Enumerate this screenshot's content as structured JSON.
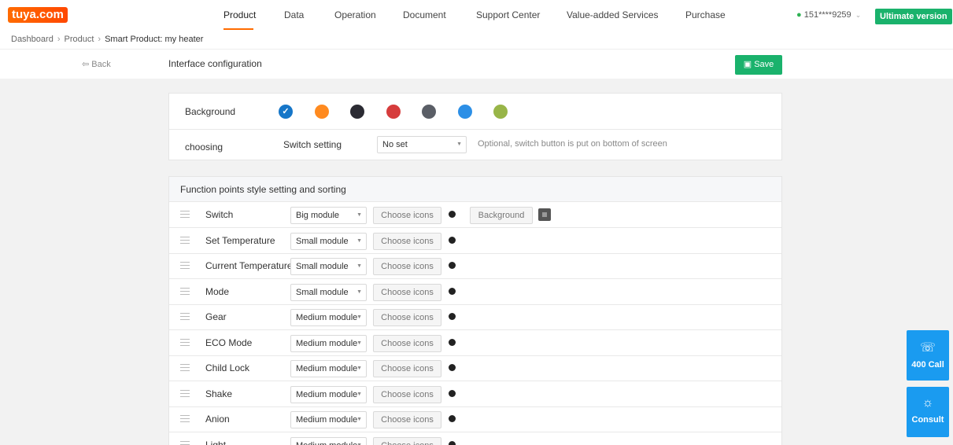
{
  "brand": {
    "logo": "tuya.com"
  },
  "nav": {
    "items": [
      {
        "label": "Product",
        "active": true
      },
      {
        "label": "Data"
      },
      {
        "label": "Operation"
      },
      {
        "label": "Document"
      },
      {
        "label": "Support Center"
      },
      {
        "label": "Value-added Services"
      },
      {
        "label": "Purchase"
      }
    ],
    "user": "151****9259",
    "ultimate": "Ultimate version"
  },
  "breadcrumb": [
    "Dashboard",
    "Product",
    "Smart Product: my heater"
  ],
  "header": {
    "back": "Back",
    "title": "Interface configuration",
    "save": "Save"
  },
  "background": {
    "label": "Background",
    "swatches": [
      "#1676c8",
      "#ff8a1f",
      "#2b2b33",
      "#d63c3c",
      "#5a5e66",
      "#2c8fe6",
      "#98b548"
    ],
    "selected": 0
  },
  "switch": {
    "label": "choosing",
    "setting_label": "Switch setting",
    "value": "No set",
    "hint": "Optional, switch button is put on bottom of screen"
  },
  "functions": {
    "title": "Function points style setting and sorting",
    "choose_label": "Choose icons",
    "background_label": "Background",
    "rows": [
      {
        "name": "Switch",
        "module": "Big module"
      },
      {
        "name": "Set Temperature",
        "module": "Small module"
      },
      {
        "name": "Current Temperature",
        "module": "Small module"
      },
      {
        "name": "Mode",
        "module": "Small module"
      },
      {
        "name": "Gear",
        "module": "Medium module"
      },
      {
        "name": "ECO Mode",
        "module": "Medium module"
      },
      {
        "name": "Child Lock",
        "module": "Medium module"
      },
      {
        "name": "Shake",
        "module": "Medium module"
      },
      {
        "name": "Anion",
        "module": "Medium module"
      },
      {
        "name": "Light",
        "module": "Medium module"
      }
    ]
  },
  "float": {
    "call": "400 Call",
    "consult": "Consult"
  }
}
